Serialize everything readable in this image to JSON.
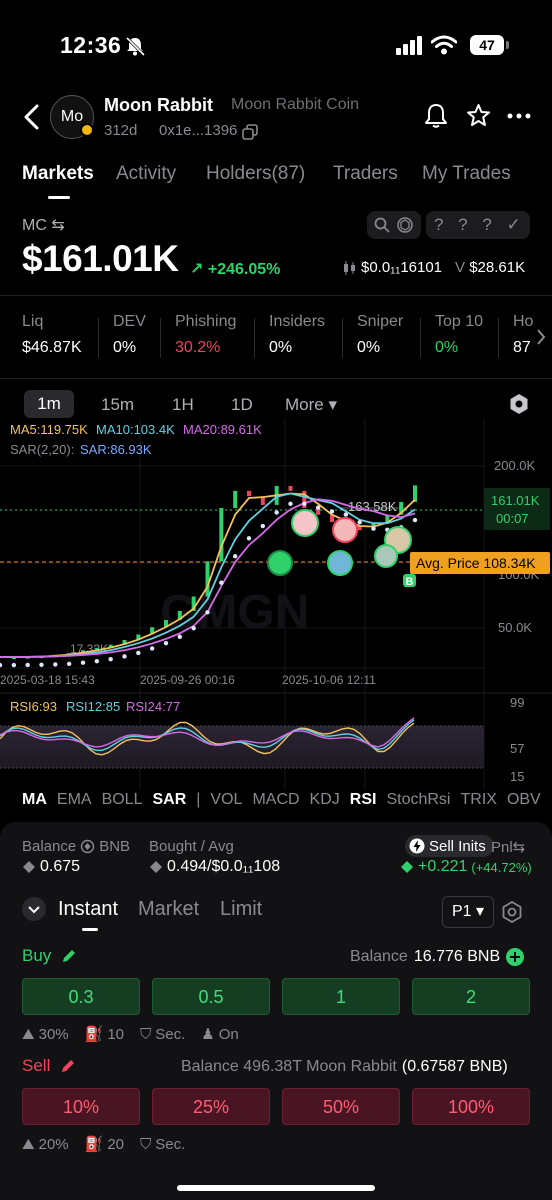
{
  "status": {
    "time": "12:36",
    "battery": "47"
  },
  "token": {
    "avatar": "Mo",
    "name": "Moon Rabbit",
    "full_name": "Moon Rabbit Coin",
    "age": "312d",
    "address": "0x1e...1396"
  },
  "tabs": [
    "Markets",
    "Activity",
    "Holders(87)",
    "Traders",
    "My Trades"
  ],
  "market": {
    "mc_label": "MC ⇆",
    "mc_value": "$161.01K",
    "mc_change": "↗ +246.05%",
    "tool_icons": "? ? ? ✓",
    "price": "$0.0₁₁16101",
    "volume_prefix": "V",
    "volume": "$28.61K"
  },
  "stats": [
    {
      "label": "Liq",
      "value": "$46.87K",
      "color": "#ffffff"
    },
    {
      "label": "DEV",
      "value": "0%",
      "color": "#ffffff"
    },
    {
      "label": "Phishing",
      "value": "30.2%",
      "color": "#f0445c"
    },
    {
      "label": "Insiders",
      "value": "0%",
      "color": "#ffffff"
    },
    {
      "label": "Sniper",
      "value": "0%",
      "color": "#ffffff"
    },
    {
      "label": "Top 10",
      "value": "0%",
      "color": "#2fd16a"
    },
    {
      "label": "Ho",
      "value": "87",
      "color": "#ffffff"
    }
  ],
  "timeframes": [
    "1m",
    "15m",
    "1H",
    "1D",
    "More ▾"
  ],
  "chart_data": {
    "type": "line",
    "title": "",
    "ma_legend": [
      {
        "text": "MA5:119.75K",
        "color": "#f3c25d"
      },
      {
        "text": "MA10:103.4K",
        "color": "#5fd1e3"
      },
      {
        "text": "MA20:89.61K",
        "color": "#d46ae6"
      }
    ],
    "sar_legend": {
      "prefix": "SAR(2,20):",
      "text": "SAR:86.93K",
      "color": "#7aa7ff"
    },
    "y_ticks": [
      "200.0K",
      "100.0K",
      "50.0K"
    ],
    "y_scale": "log",
    "x_ticks": [
      "2025-03-18 15:43",
      "2025-09-26 00:16",
      "2025-10-06 12:11"
    ],
    "high_label": "163.58K",
    "low_label": "17.32K",
    "current_price": "161.01K",
    "current_countdown": "00:07",
    "avg_price_label": "Avg. Price 108.34K",
    "price_series": [
      17.3,
      17.3,
      17.4,
      17.5,
      17.8,
      18.2,
      18.9,
      19.5,
      20.3,
      21.6,
      23.2,
      25.5,
      28,
      31.5,
      38,
      60,
      120,
      150,
      140,
      125,
      160,
      150,
      120,
      110,
      100,
      95,
      90,
      98,
      110,
      130,
      161
    ],
    "rsi_legend": [
      {
        "text": "RSI6:93",
        "color": "#f3c25d"
      },
      {
        "text": "RSI12:85",
        "color": "#5fd1e3"
      },
      {
        "text": "RSI24:77",
        "color": "#d46ae6"
      }
    ],
    "rsi_ticks": [
      "99",
      "57",
      "15"
    ]
  },
  "indicators": [
    "MA",
    "EMA",
    "BOLL",
    "SAR",
    "|",
    "VOL",
    "MACD",
    "KDJ",
    "RSI",
    "StochRsi",
    "TRIX",
    "OBV"
  ],
  "indicators_on": [
    "MA",
    "SAR",
    "RSI"
  ],
  "position": {
    "balance_label": "Balance",
    "balance_unit": "BNB",
    "balance_value": "0.675",
    "bought_label": "Bought / Avg",
    "bought_value": "0.494/$0.0₁₁108",
    "sell_inits": "Sell Inits",
    "pnl_label": "Pnl⇆",
    "pnl_value": "+0.221",
    "pnl_pct": "(+44.72%)"
  },
  "trade": {
    "modes": [
      "Instant",
      "Market",
      "Limit"
    ],
    "preset": "P1 ▾",
    "buy_label": "Buy",
    "buy_balance_label": "Balance",
    "buy_balance": "16.776 BNB",
    "buy_amounts": [
      "0.3",
      "0.5",
      "1",
      "2"
    ],
    "buy_opts": [
      "30%",
      "10",
      "Sec.",
      "On"
    ],
    "sell_label": "Sell",
    "sell_balance": "Balance 496.38T Moon Rabbit",
    "sell_balance_bnb": "(0.67587 BNB)",
    "sell_amounts": [
      "10%",
      "25%",
      "50%",
      "100%"
    ],
    "sell_opts": [
      "20%",
      "20",
      "Sec."
    ]
  }
}
